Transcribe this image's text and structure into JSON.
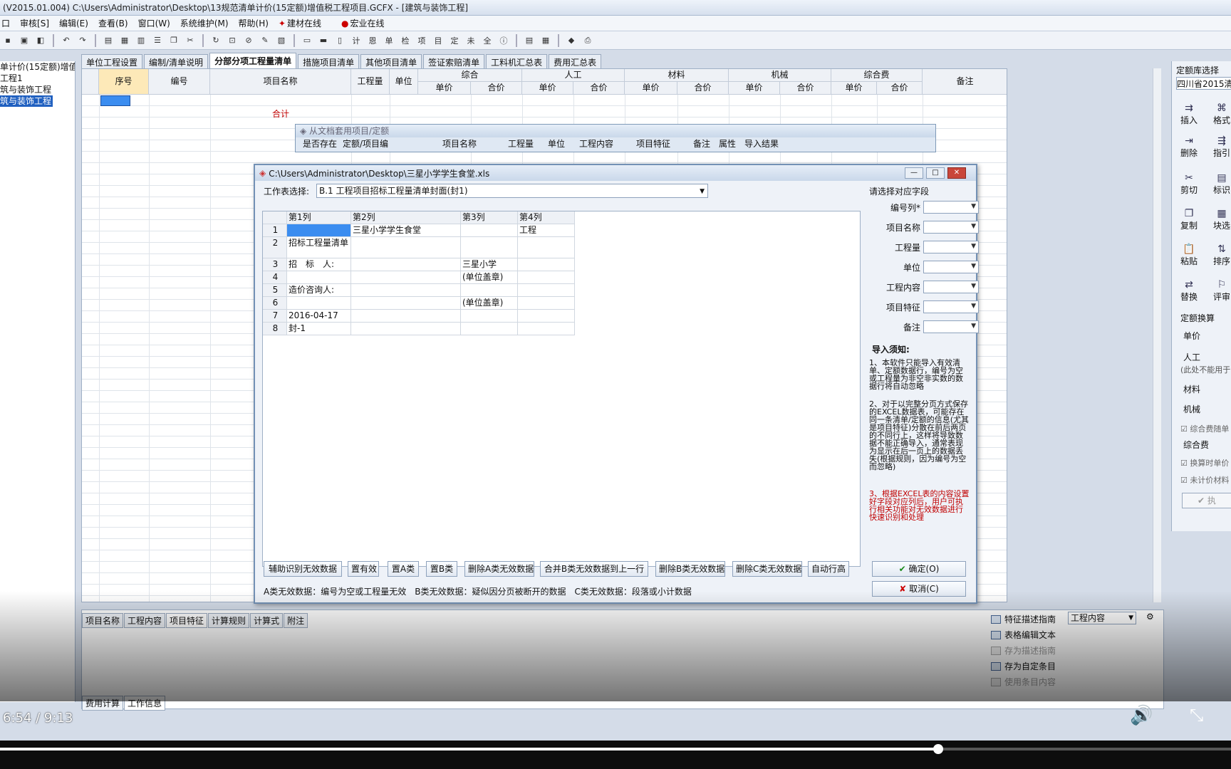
{
  "app": {
    "title": "(V2015.01.004) C:\\Users\\Administrator\\Desktop\\13规范清单计价(15定额)增值税工程项目.GCFX - [建筑与装饰工程]"
  },
  "menu": {
    "items": [
      "审核[S]",
      "编辑(E)",
      "查看(B)",
      "窗口(W)",
      "系统维护(M)",
      "帮助(H)"
    ],
    "online1": "建材在线",
    "online2": "宏业在线"
  },
  "tree": {
    "items": [
      "单计价(15定额)增值",
      "工程1",
      "筑与装饰工程",
      "筑与装饰工程"
    ]
  },
  "tabs": [
    "单位工程设置",
    "编制/清单说明",
    "分部分项工程量清单",
    "措施项目清单",
    "其他项目清单",
    "签证索赔清单",
    "工料机汇总表",
    "费用汇总表"
  ],
  "grid": {
    "headers": {
      "seq": "序号",
      "code": "编号",
      "name": "项目名称",
      "qty": "工程量",
      "unit": "单位",
      "comp": "综合",
      "labor": "人工",
      "material": "材料",
      "machine": "机械",
      "fee": "综合费",
      "note": "备注",
      "unitprice": "单价",
      "total": "合价"
    },
    "total_label": "合计"
  },
  "right_panel": {
    "title": "定额库选择",
    "db": "四川省2015清单",
    "buttons": [
      "插入",
      "删除",
      "剪切",
      "复制",
      "粘贴",
      "替换"
    ],
    "buttons2": [
      "格式",
      "指引",
      "标识",
      "块选",
      "排序",
      "评审"
    ],
    "calc_title": "定额换算",
    "unit_price": "单价",
    "labor": "人工",
    "note": "(此处不能用于",
    "material": "材料",
    "machine": "机械",
    "comp_check": "综合费随单",
    "comp_fee": "综合费",
    "check2": "换算时单价",
    "check3": "未计价材料",
    "ok": "执"
  },
  "dialog_back": {
    "title": "从文档套用项目/定额",
    "cols": [
      "是否存在",
      "定额/项目编",
      "项目名称",
      "工程量",
      "单位",
      "工程内容",
      "项目特征",
      "备注",
      "属性",
      "导入结果"
    ]
  },
  "dialog": {
    "title": "C:\\Users\\Administrator\\Desktop\\三星小学学生食堂.xls",
    "sheet_label": "工作表选择:",
    "sheet_value": "B.1 工程项目招标工程量清单封面(封1)",
    "col_headers": [
      "第1列",
      "第2列",
      "第3列",
      "第4列"
    ],
    "rows": [
      [
        "1",
        "",
        "三星小学学生食堂",
        "",
        "工程"
      ],
      [
        "2",
        "招标工程量清单",
        "",
        "",
        ""
      ],
      [
        "3",
        "招　标　人:",
        "",
        "三星小学",
        ""
      ],
      [
        "4",
        "",
        "",
        "(单位盖章)",
        ""
      ],
      [
        "5",
        "造价咨询人:",
        "",
        "",
        ""
      ],
      [
        "6",
        "",
        "",
        "(单位盖章)",
        ""
      ],
      [
        "7",
        "2016-04-17",
        "",
        "",
        ""
      ],
      [
        "8",
        "封-1",
        "",
        "",
        ""
      ]
    ],
    "field_title": "请选择对应字段",
    "fields": [
      "编号列*",
      "项目名称",
      "工程量",
      "单位",
      "工程内容",
      "项目特征",
      "备注"
    ],
    "notes_title": "导入须知:",
    "note1": "1、本软件只能导入有效清单、定额数据行，编号为空或工程量为非空非实数的数据行将自动忽略",
    "note2": "2、对于以完整分页方式保存的EXCEL数据表，可能存在同一条清单/定额的信息(尤其是项目特征)分散在前后两页的不同行上，这样将导致数据不能正确导入，通常表现为显示在后一页上的数据丢失(根据规则，因为编号为空而忽略)",
    "note3": "3、根据EXCEL表的内容设置好字段对应列后，用户可执行相关功能对无效数据进行快速识别和处理",
    "buttons": [
      "辅助识别无效数据",
      "置有效",
      "置A类",
      "置B类",
      "删除A类无效数据",
      "合并B类无效数据到上一行",
      "删除B类无效数据",
      "删除C类无效数据",
      "自动行高"
    ],
    "ok": "确定(O)",
    "cancel": "取消(C)",
    "legend": "A类无效数据：编号为空或工程量无效　B类无效数据：疑似因分页被断开的数据　C类无效数据：段落或小计数据"
  },
  "bottom": {
    "tabs": [
      "项目名称",
      "工程内容",
      "项目特征",
      "计算规则",
      "计算式",
      "附注"
    ],
    "options": [
      "特征描述指南",
      "表格编辑文本",
      "存为描述指南",
      "存为自定条目",
      "使用条目内容"
    ],
    "dropdown": "工程内容",
    "tabs2": [
      "费用计算",
      "工作信息"
    ]
  },
  "video": {
    "time": "6:54 / 9:13",
    "progress": 0.762
  }
}
